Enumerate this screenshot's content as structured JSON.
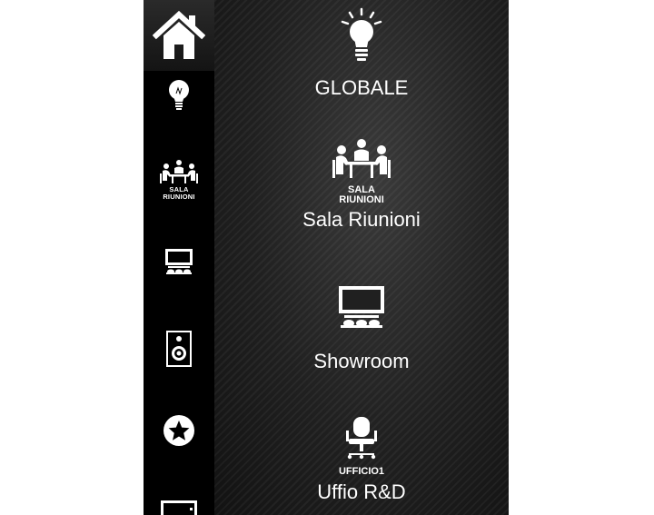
{
  "sidebar": {
    "items": [
      {
        "icon": "home-icon",
        "label": ""
      },
      {
        "icon": "light-bulb-icon",
        "label": ""
      },
      {
        "icon": "meeting-room-icon",
        "label": "SALA\nRIUNIONI"
      },
      {
        "icon": "showroom-screen-icon",
        "label": ""
      },
      {
        "icon": "speaker-icon",
        "label": ""
      },
      {
        "icon": "star-icon",
        "label": ""
      },
      {
        "icon": "tv-icon",
        "label": ""
      }
    ]
  },
  "main": {
    "zones": [
      {
        "icon": "light-bulb-icon",
        "sublabel": "",
        "label": "GLOBALE"
      },
      {
        "icon": "meeting-room-icon",
        "sublabel": "SALA\nRIUNIONI",
        "label": "Sala Riunioni"
      },
      {
        "icon": "showroom-screen-icon",
        "sublabel": "",
        "label": "Showroom"
      },
      {
        "icon": "office-chair-icon",
        "sublabel": "UFFICIO1",
        "label": "Uffio R&D"
      }
    ]
  },
  "colors": {
    "sidebar_bg": "#000000",
    "panel_bg": "#202020",
    "icon": "#ffffff"
  }
}
